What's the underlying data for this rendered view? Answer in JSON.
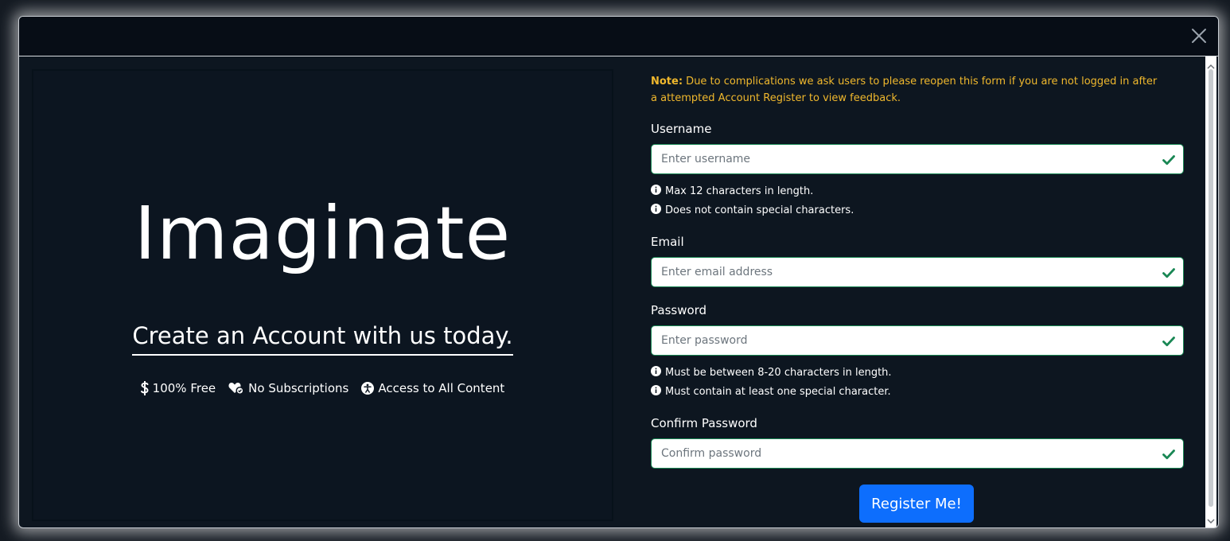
{
  "colors": {
    "accent": "#0d6efd",
    "valid": "#198754",
    "note": "#f0b82d",
    "panel": "#0c1520",
    "header": "#070d16"
  },
  "header": {
    "close_icon": "close-icon"
  },
  "brand": {
    "title": "Imaginate",
    "tagline": "Create an Account with us today.",
    "features": [
      {
        "icon": "dollar-icon",
        "label": "100% Free"
      },
      {
        "icon": "hearts-icon",
        "label": "No Subscriptions"
      },
      {
        "icon": "accessibility-icon",
        "label": "Access to All Content"
      }
    ]
  },
  "form": {
    "note_label": "Note:",
    "note_text": " Due to complications we ask users to please reopen this form if you are not logged in after a attempted Account Register to view feedback.",
    "username": {
      "label": "Username",
      "placeholder": "Enter username",
      "hints": [
        "Max 12 characters in length.",
        "Does not contain special characters."
      ]
    },
    "email": {
      "label": "Email",
      "placeholder": "Enter email address"
    },
    "password": {
      "label": "Password",
      "placeholder": "Enter password",
      "hints": [
        "Must be between 8-20 characters in length.",
        "Must contain at least one special character."
      ]
    },
    "confirm_password": {
      "label": "Confirm Password",
      "placeholder": "Confirm password"
    },
    "submit_label": "Register Me!"
  }
}
